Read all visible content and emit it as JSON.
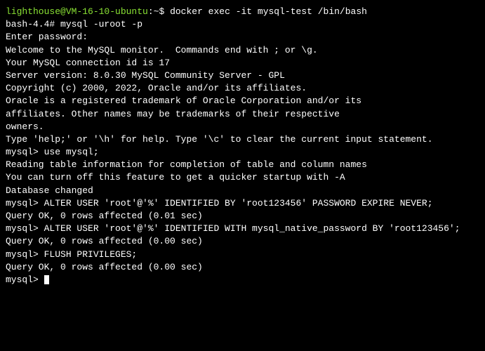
{
  "prompt": {
    "user": "lighthouse@VM-16-10-ubuntu",
    "colon": ":",
    "path": "~",
    "sign": "$ "
  },
  "lines": {
    "l1_cmd": "docker exec -it mysql-test /bin/bash",
    "l2": "bash-4.4# mysql -uroot -p",
    "l3": "Enter password:",
    "l4": "Welcome to the MySQL monitor.  Commands end with ; or \\g.",
    "l5": "Your MySQL connection id is 17",
    "l6": "Server version: 8.0.30 MySQL Community Server - GPL",
    "l7": "",
    "l8": "Copyright (c) 2000, 2022, Oracle and/or its affiliates.",
    "l9": "",
    "l10": "Oracle is a registered trademark of Oracle Corporation and/or its",
    "l11": "affiliates. Other names may be trademarks of their respective",
    "l12": "owners.",
    "l13": "",
    "l14": "Type 'help;' or '\\h' for help. Type '\\c' to clear the current input statement.",
    "l15": "",
    "l16": "mysql> use mysql;",
    "l17": "Reading table information for completion of table and column names",
    "l18": "You can turn off this feature to get a quicker startup with -A",
    "l19": "",
    "l20": "Database changed",
    "l21": "mysql> ALTER USER 'root'@'%' IDENTIFIED BY 'root123456' PASSWORD EXPIRE NEVER;",
    "l22": "Query OK, 0 rows affected (0.01 sec)",
    "l23": "",
    "l24": "mysql> ALTER USER 'root'@'%' IDENTIFIED WITH mysql_native_password BY 'root123456';",
    "l25": "Query OK, 0 rows affected (0.00 sec)",
    "l26": "",
    "l27": "mysql> FLUSH PRIVILEGES;",
    "l28": "Query OK, 0 rows affected (0.00 sec)",
    "l29": "",
    "l30": "mysql> "
  }
}
